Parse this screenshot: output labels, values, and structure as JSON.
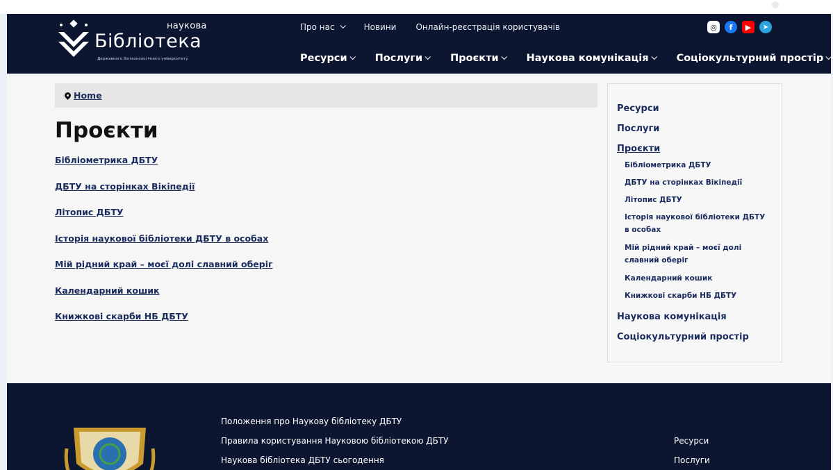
{
  "header": {
    "logo": {
      "small": "наукова",
      "big": "Бібліотека",
      "tiny": "Державного біотехнологічного університету"
    },
    "top_nav": [
      {
        "label": "Про нас",
        "dropdown": true
      },
      {
        "label": "Новини",
        "dropdown": false
      },
      {
        "label": "Онлайн-реєстрація користувачів",
        "dropdown": false
      }
    ],
    "social": [
      {
        "name": "instagram-icon",
        "glyph": "◎",
        "color": "#0d1630"
      },
      {
        "name": "facebook-icon",
        "glyph": "f",
        "color": "#1877f2"
      },
      {
        "name": "youtube-icon",
        "glyph": "▶",
        "color": "#ff0000"
      },
      {
        "name": "telegram-icon",
        "glyph": "➤",
        "color": "#2aa3e0"
      }
    ],
    "main_nav": [
      "Ресурси",
      "Послуги",
      "Проєкти",
      "Наукова комунікація",
      "Соціокультурний простір"
    ]
  },
  "breadcrumb": {
    "home": "Home"
  },
  "page": {
    "title": "Проєкти",
    "links": [
      "Бібліометрика ДБТУ",
      "ДБТУ на сторінках Вікіпедії",
      "Літопис ДБТУ",
      "Історія наукової бібліотеки ДБТУ в особах",
      "Мій рідний край – моєї долі славний оберіг",
      "Календарний кошик",
      "Книжкові скарби НБ ДБТУ"
    ]
  },
  "sidebar": {
    "items": [
      "Ресурси",
      "Послуги",
      "Проєкти",
      "Наукова комунікація",
      "Соціокультурний простір"
    ],
    "sub_items": [
      "Бібліометрика ДБТУ",
      "ДБТУ на сторінках Вікіпедії",
      "Літопис ДБТУ",
      "Історія наукової бібліотеки ДБТУ в особах",
      "Мій рідний край – моєї долі славний оберіг",
      "Календарний кошик",
      "Книжкові скарби НБ ДБТУ"
    ]
  },
  "footer": {
    "links": [
      "Положення про Наукову бібліотеку ДБТУ",
      "Правила користування Науковою бібліотекою ДБТУ",
      "Наукова бібліотека ДБТУ сьогодення"
    ],
    "right": [
      "Ресурси",
      "Послуги"
    ]
  },
  "colors": {
    "header_bg": "#0d1630",
    "link": "#1a2b5e",
    "page_bg": "#f6f6f6"
  }
}
